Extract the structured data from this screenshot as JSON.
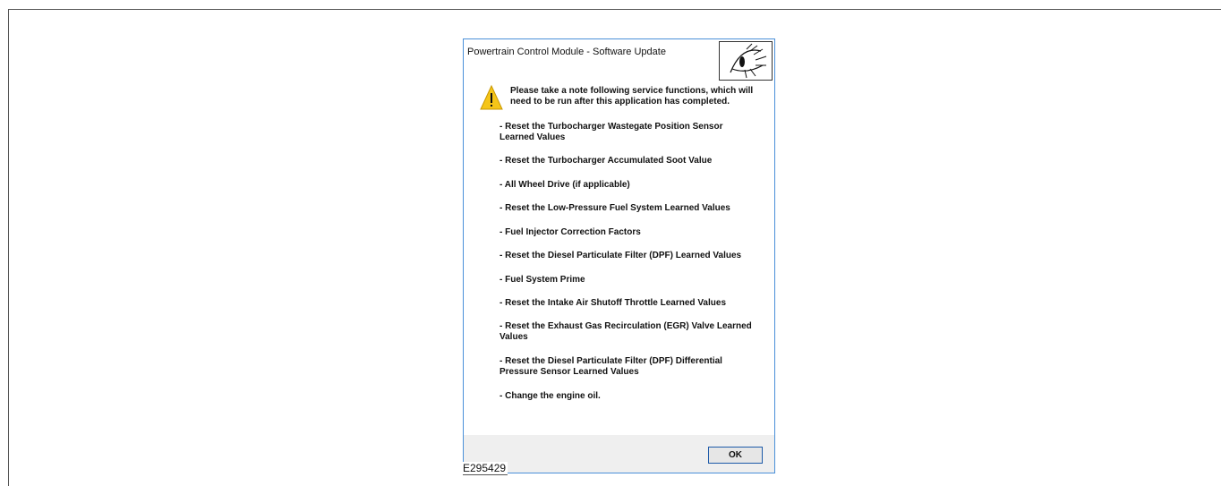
{
  "dialog": {
    "title": "Powertrain Control Module - Software Update",
    "logo_icon": "eye-manual-icon",
    "warning_icon": "warning-icon",
    "intro": "Please take a note following service functions, which will need to be run after this application has completed.",
    "items": [
      " - Reset the Turbocharger Wastegate Position Sensor Learned Values",
      " - Reset the Turbocharger Accumulated Soot Value",
      " - All Wheel Drive (if applicable)",
      " - Reset the Low-Pressure Fuel System Learned Values",
      " - Fuel Injector Correction Factors",
      " - Reset the Diesel Particulate Filter (DPF) Learned Values",
      " - Fuel System Prime",
      " - Reset the Intake Air Shutoff Throttle Learned Values",
      " - Reset the Exhaust Gas Recirculation (EGR) Valve Learned Values",
      " - Reset the Diesel Particulate Filter (DPF) Differential Pressure Sensor Learned Values",
      " - Change the engine oil."
    ],
    "ok_label": "OK"
  },
  "figure_id": "E295429",
  "colors": {
    "dialog_border": "#4a90d9",
    "footer_bg": "#efefef",
    "button_border": "#1d5aa8",
    "warning_fill": "#f5c518"
  }
}
